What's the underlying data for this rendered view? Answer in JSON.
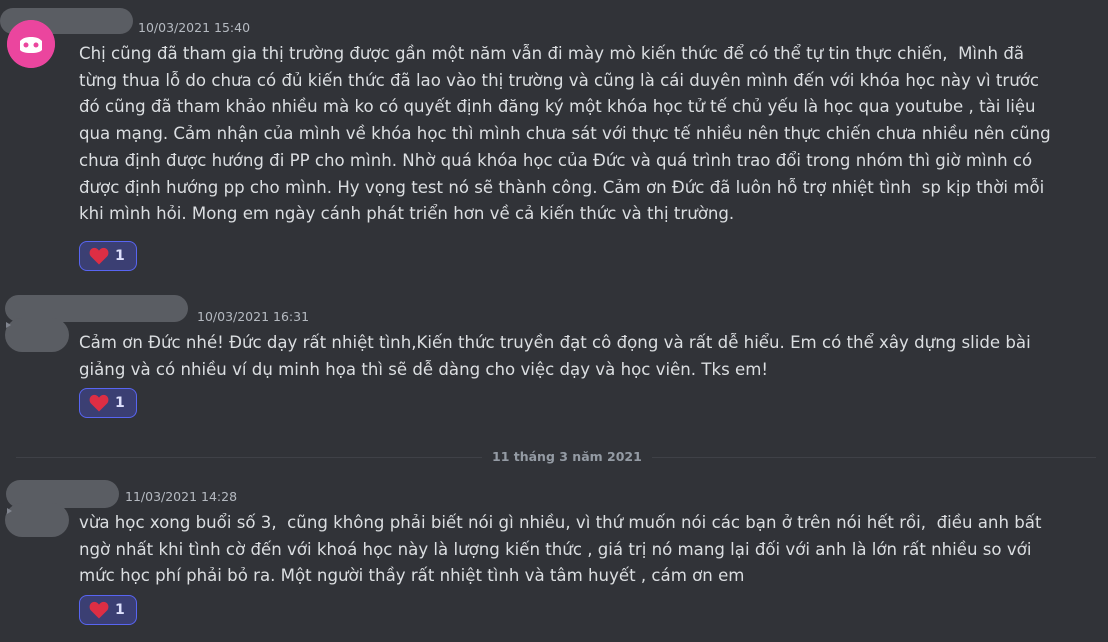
{
  "messages": [
    {
      "timestamp": "10/03/2021 15:40",
      "text": "Chị cũng đã tham gia thị trường được gần một năm vẫn đi mày mò kiến thức để có thể tự tin thực chiến,  Mình đã\ntừng thua lỗ do chưa có đủ kiến thức đã lao vào thị trường và cũng là cái duyên mình đến với khóa học này vì trước\nđó cũng đã tham khảo nhiều mà ko có quyết định đăng ký một khóa học tử tế chủ yếu là học qua youtube , tài liệu\nqua mạng. Cảm nhận của mình về khóa học thì mình chưa sát với thực tế nhiều nên thực chiến chưa nhiều nên cũng\nchưa định được hướng đi PP cho mình. Nhờ quá khóa học của Đức và quá trình trao đổi trong nhóm thì giờ mình có\nđược định hướng pp cho mình. Hy vọng test nó sẽ thành công. Cảm ơn Đức đã luôn hỗ trợ nhiệt tình  sp kịp thời mỗi\nkhi mình hỏi. Mong em ngày cánh phát triển hơn về cả kiến thức và thị trường.",
      "reaction": {
        "emoji": "heart-icon",
        "count": "1"
      }
    },
    {
      "timestamp": "10/03/2021 16:31",
      "text": "Cảm ơn Đức nhé! Đức dạy rất nhiệt tình,Kiến thức truyền đạt cô đọng và rất dễ hiểu. Em có thể xây dựng slide bài\ngiảng và có nhiều ví dụ minh họa thì sẽ dễ dàng cho việc dạy và học viên. Tks em!",
      "reaction": {
        "emoji": "heart-icon",
        "count": "1"
      }
    },
    {
      "timestamp": "11/03/2021 14:28",
      "text": "vừa học xong buổi số 3,  cũng không phải biết nói gì nhiều, vì thứ muốn nói các bạn ở trên nói hết rồi,  điều anh bất\nngờ nhất khi tình cờ đến với khoá học này là lượng kiến thức , giá trị nó mang lại đối với anh là lớn rất nhiều so với\nmức học phí phải bỏ ra. Một người thầy rất nhiệt tình và tâm huyết , cám ơn em",
      "reaction": {
        "emoji": "heart-icon",
        "count": "1"
      }
    }
  ],
  "date_divider": "11 tháng 3 năm 2021",
  "colors": {
    "background": "#313338",
    "text": "#dbdee1",
    "reaction_bg": "#3b3f73",
    "reaction_border": "#5865f2",
    "heart": "#dd2e44",
    "avatar_pink": "#eb459e"
  }
}
